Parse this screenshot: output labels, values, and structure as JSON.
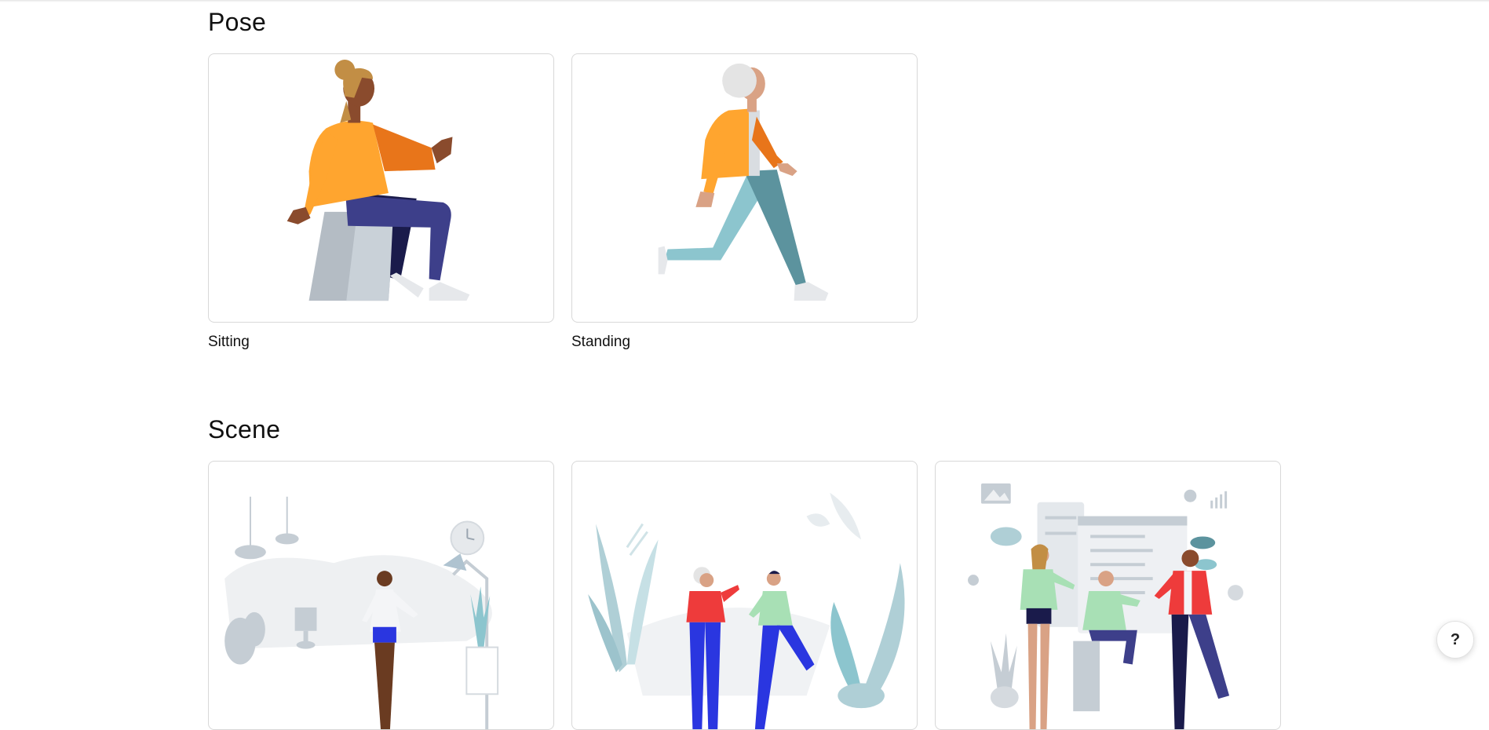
{
  "sections": {
    "pose": {
      "title": "Pose",
      "cards": [
        {
          "label": "Sitting",
          "illustration": "sitting-person-illustration"
        },
        {
          "label": "Standing",
          "illustration": "standing-person-illustration"
        }
      ]
    },
    "scene": {
      "title": "Scene",
      "cards": [
        {
          "label": "",
          "illustration": "living-room-scene-illustration"
        },
        {
          "label": "",
          "illustration": "greeting-outdoor-scene-illustration"
        },
        {
          "label": "",
          "illustration": "dashboard-team-scene-illustration"
        }
      ]
    }
  },
  "help": {
    "label": "?"
  },
  "colors": {
    "orange": "#FFA52F",
    "dark_orange": "#E8751A",
    "navy": "#3D3F8A",
    "teal": "#5C939E",
    "light_teal": "#8CC5CE",
    "red": "#EE3B3B",
    "blue": "#2A36E0",
    "mint": "#A8E0B5",
    "grey": "#C5CDD4"
  }
}
